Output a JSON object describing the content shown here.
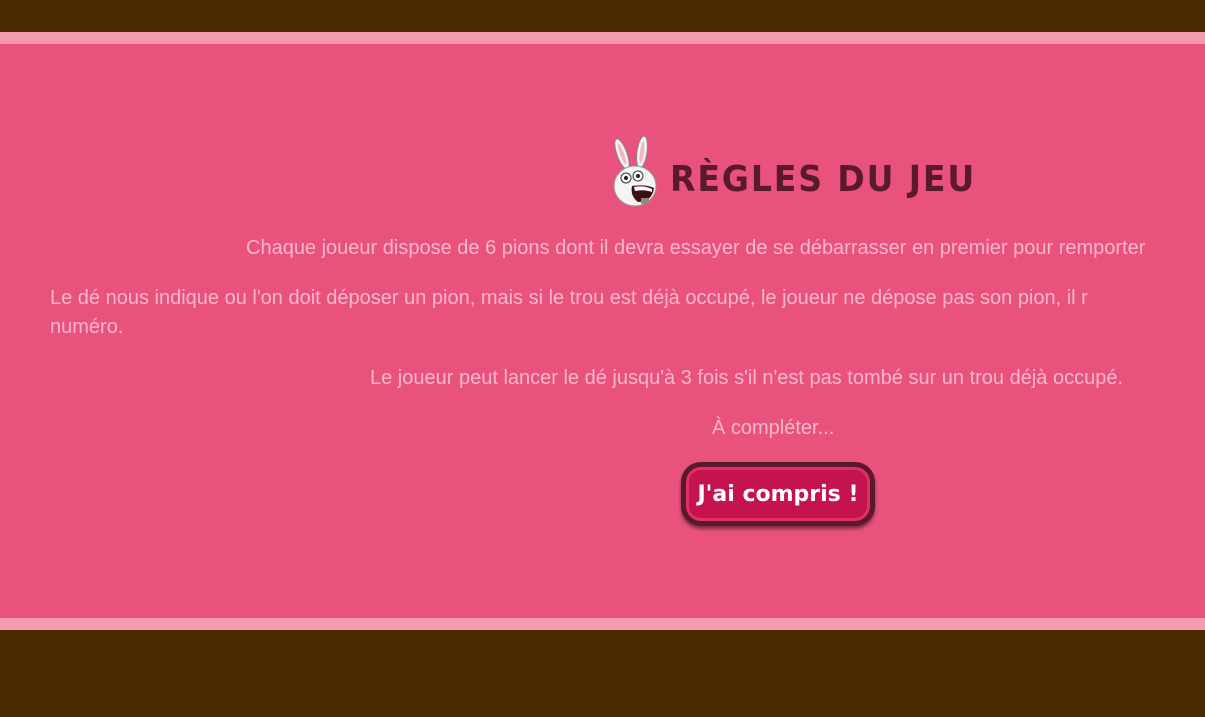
{
  "rules": {
    "title": "RÈGLES DU JEU",
    "mascot_icon": "rabbid-icon",
    "paragraphs": [
      "Chaque joueur dispose de 6 pions dont il devra essayer de se débarrasser en premier pour remporter",
      "Le dé nous indique ou l'on doit déposer un pion, mais si le trou est déjà occupé, le joueur ne dépose pas son pion, il r",
      "numéro.",
      "Le joueur peut lancer le dé jusqu'à 3 fois s'il n'est pas tombé sur un trou déjà occupé.",
      "À compléter..."
    ],
    "confirm_button": "J'ai compris !"
  },
  "colors": {
    "panel": "#e8527c",
    "stripe": "#f59bb0",
    "frame": "#4a2a00",
    "title": "#5a1a2c",
    "button": "#c4134f",
    "text": "#f7b7c9"
  }
}
